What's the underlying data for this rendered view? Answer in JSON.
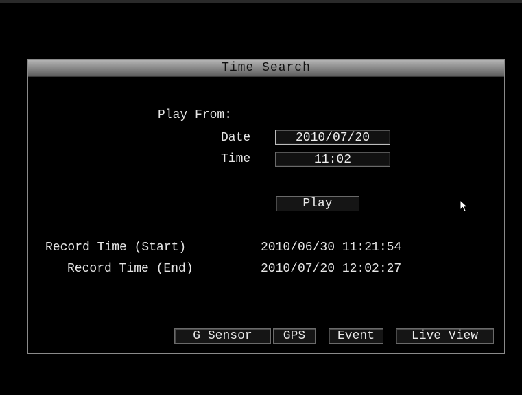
{
  "window": {
    "title": "Time Search"
  },
  "play_from": {
    "heading": "Play From:",
    "date_label": "Date",
    "date_value": "2010/07/20",
    "time_label": "Time",
    "time_value": "11:02",
    "play_label": "Play"
  },
  "record": {
    "start_label": "Record Time (Start)",
    "start_value": "2010/06/30 11:21:54",
    "end_label": "Record Time (End)",
    "end_value": "2010/07/20 12:02:27"
  },
  "bottom_buttons": {
    "g_sensor": "G Sensor",
    "gps": "GPS",
    "event": "Event",
    "live_view": "Live View"
  },
  "icons": {
    "cursor": "mouse-pointer-icon"
  }
}
